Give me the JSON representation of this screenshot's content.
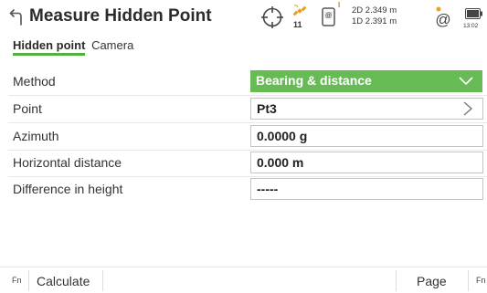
{
  "header": {
    "title": "Measure Hidden Point",
    "status": {
      "satellites": "11",
      "device_sup": "I",
      "quality_2d": "2D 2.349 m",
      "quality_1d": "1D 2.391 m",
      "time": "13:02"
    },
    "icons": {
      "back": "back-arrow-icon",
      "crosshair": "crosshair-icon",
      "satellite": "satellite-icon",
      "device": "device-icon",
      "at": "at-icon",
      "battery": "battery-icon"
    }
  },
  "tabs": [
    {
      "label": "Hidden point",
      "active": true
    },
    {
      "label": "Camera",
      "active": false
    }
  ],
  "form": {
    "method": {
      "label": "Method",
      "value": "Bearing & distance"
    },
    "point": {
      "label": "Point",
      "value": "Pt3"
    },
    "azimuth": {
      "label": "Azimuth",
      "value": "0.0000 g"
    },
    "horizontal_distance": {
      "label": "Horizontal distance",
      "value": "0.000 m"
    },
    "difference_in_height": {
      "label": "Difference in height",
      "value": "-----"
    }
  },
  "bottom_bar": {
    "fn_left": "Fn",
    "calculate": "Calculate",
    "page": "Page",
    "fn_right": "Fn"
  },
  "colors": {
    "accent_green": "#66bb55",
    "tab_underline": "#4db33d",
    "satellite_orange": "#e8a020"
  }
}
